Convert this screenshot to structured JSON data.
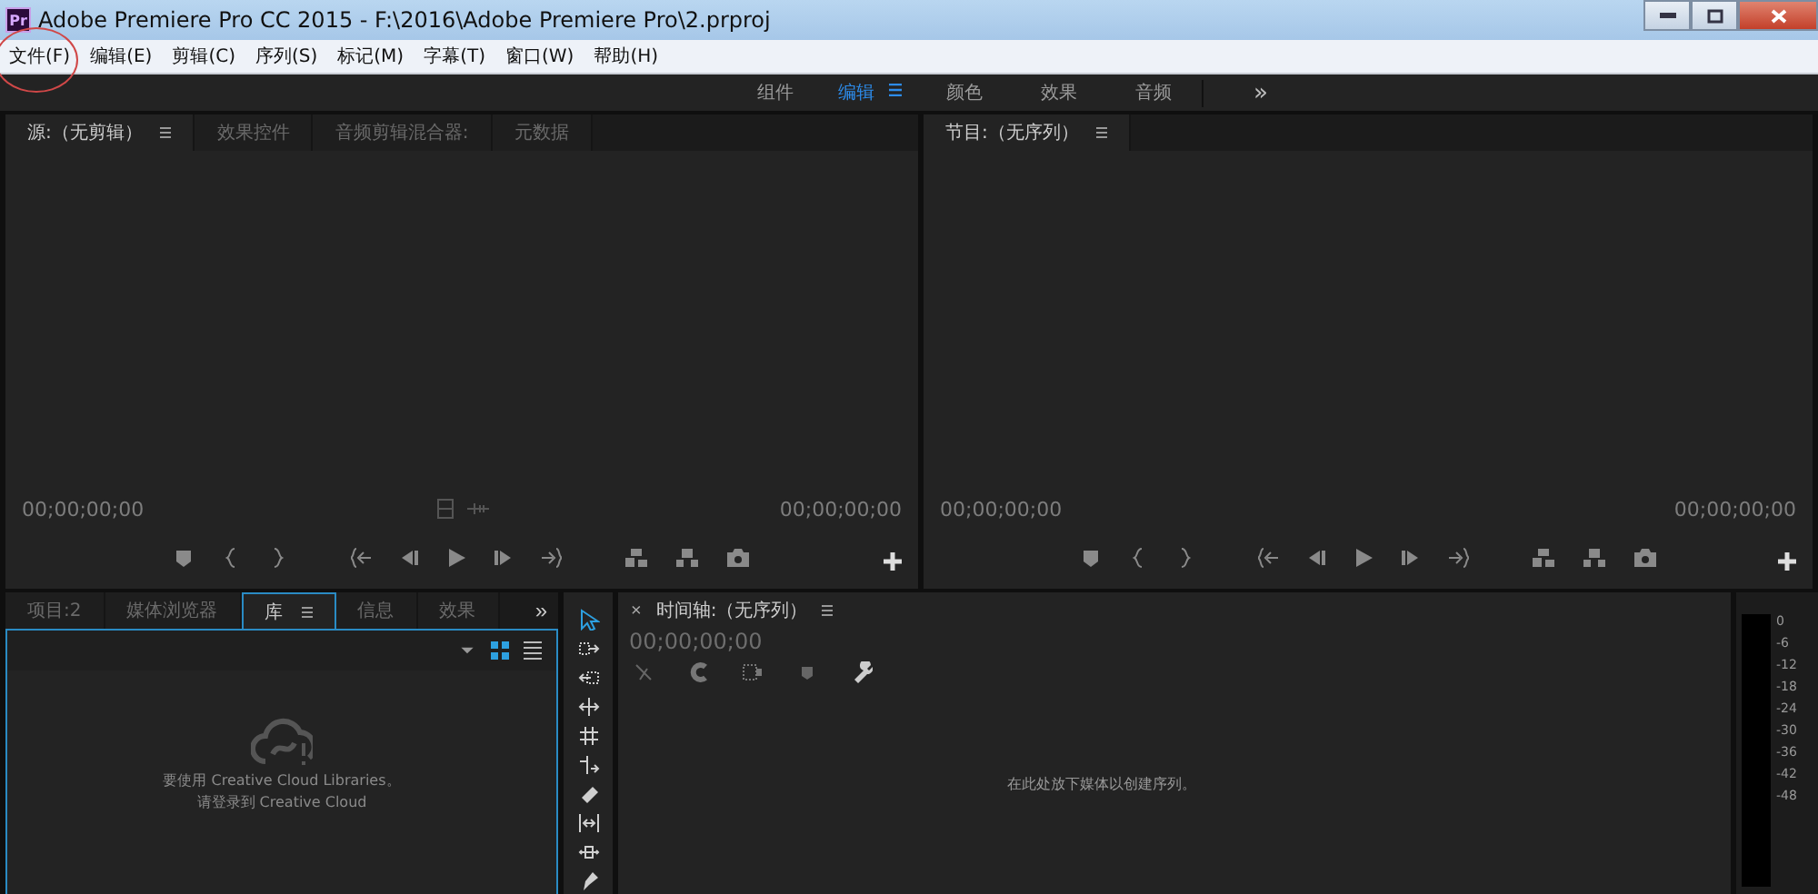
{
  "window": {
    "app_icon": "Pr",
    "title": "Adobe Premiere Pro CC 2015 - F:\\2016\\Adobe Premiere Pro\\2.prproj"
  },
  "menu": [
    {
      "label": "文件(F)",
      "circled": true
    },
    {
      "label": "编辑(E)",
      "circled": false
    },
    {
      "label": "剪辑(C)",
      "circled": false
    },
    {
      "label": "序列(S)",
      "circled": false
    },
    {
      "label": "标记(M)",
      "circled": false
    },
    {
      "label": "字幕(T)",
      "circled": false
    },
    {
      "label": "窗口(W)",
      "circled": false
    },
    {
      "label": "帮助(H)",
      "circled": false
    }
  ],
  "workspaces": {
    "items": [
      {
        "label": "组件",
        "selected": false
      },
      {
        "label": "编辑",
        "selected": true
      },
      {
        "label": "颜色",
        "selected": false
      },
      {
        "label": "效果",
        "selected": false
      },
      {
        "label": "音频",
        "selected": false
      }
    ],
    "overflow": "»"
  },
  "source_panel": {
    "tabs": [
      {
        "label": "源:（无剪辑）",
        "selected": true
      },
      {
        "label": "效果控件",
        "selected": false
      },
      {
        "label": "音频剪辑混合器:",
        "selected": false
      },
      {
        "label": "元数据",
        "selected": false
      }
    ],
    "timecode_left": "00;00;00;00",
    "timecode_right": "00;00;00;00"
  },
  "program_panel": {
    "tabs": [
      {
        "label": "节目:（无序列）",
        "selected": true
      }
    ],
    "timecode_left": "00;00;00;00",
    "timecode_right": "00;00;00;00"
  },
  "project_panel": {
    "tabs": [
      {
        "label": "项目:2",
        "selected": false
      },
      {
        "label": "媒体浏览器",
        "selected": false
      },
      {
        "label": "库",
        "selected": true
      },
      {
        "label": "信息",
        "selected": false
      },
      {
        "label": "效果",
        "selected": false
      }
    ],
    "overflow": "»",
    "grid_view_selected": true,
    "message_lines": [
      "要使用 Creative Cloud Libraries。",
      "请登录到 Creative Cloud"
    ]
  },
  "tools": [
    {
      "kind": "selection",
      "selected": true
    },
    {
      "kind": "track-select",
      "selected": false
    },
    {
      "kind": "ripple",
      "selected": false
    },
    {
      "kind": "rolling",
      "selected": false
    },
    {
      "kind": "rate",
      "selected": false
    },
    {
      "kind": "razor-split",
      "selected": false
    },
    {
      "kind": "razor",
      "selected": false
    },
    {
      "kind": "slip",
      "selected": false
    },
    {
      "kind": "slide",
      "selected": false
    },
    {
      "kind": "pen",
      "selected": false
    }
  ],
  "timeline": {
    "close": "×",
    "title": "时间轴:（无序列）",
    "timecode": "00;00;00;00",
    "drop_hint": "在此处放下媒体以创建序列。"
  },
  "audio_meter": {
    "ticks": [
      "0",
      "-6",
      "-12",
      "-18",
      "-24",
      "-30",
      "-36",
      "-42",
      "-48"
    ]
  }
}
